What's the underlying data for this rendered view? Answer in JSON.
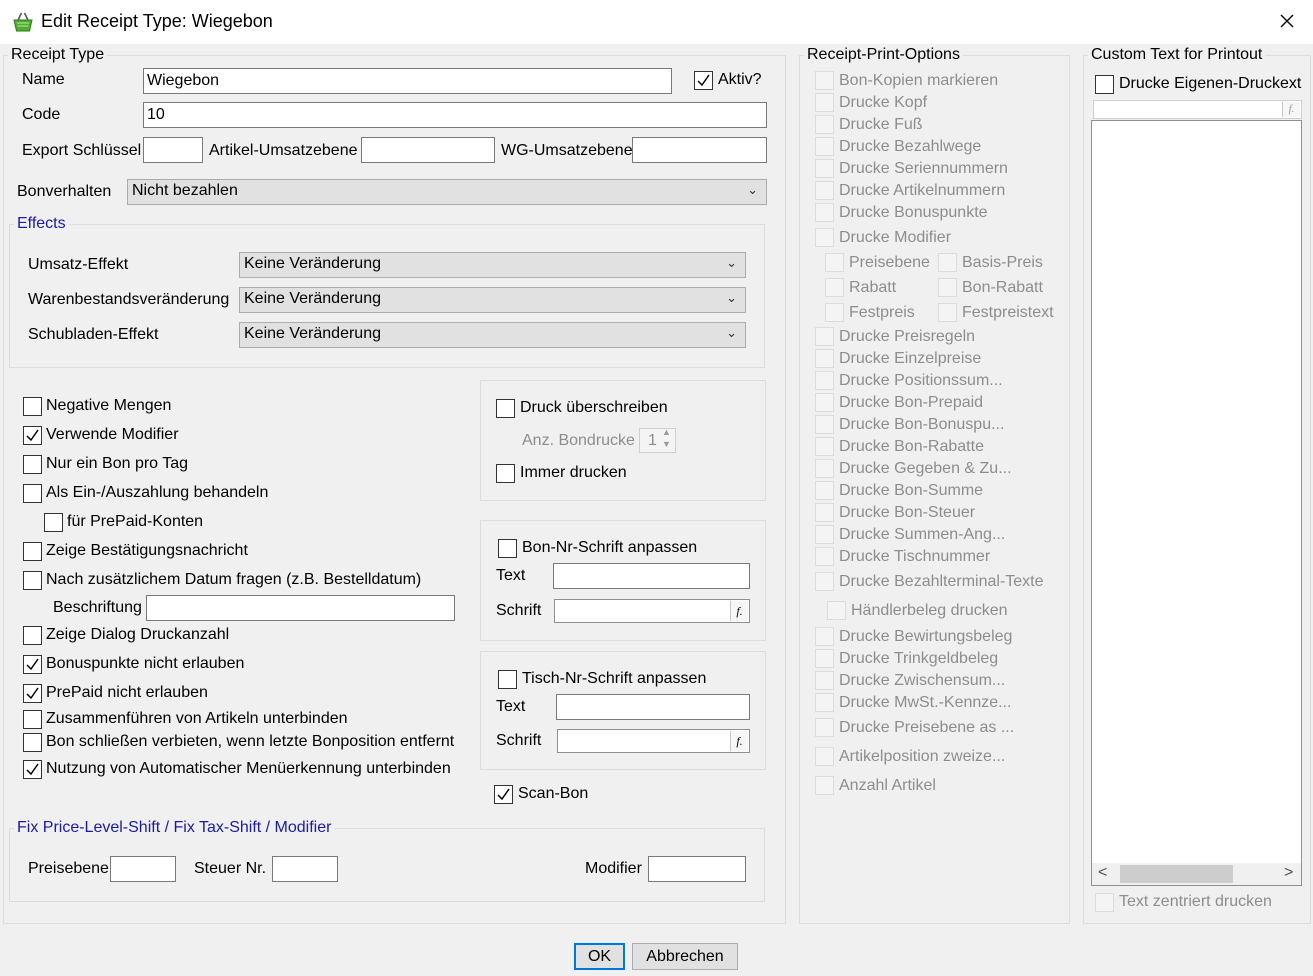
{
  "window": {
    "title": "Edit Receipt Type: Wiegebon",
    "icon": "shopping-basket-icon",
    "close_icon": "close-icon"
  },
  "receipt_type": {
    "legend": "Receipt Type",
    "name_label": "Name",
    "name_value": "Wiegebon",
    "aktiv_label": "Aktiv?",
    "code_label": "Code",
    "code_value": "10",
    "export_label": "Export Schlüssel",
    "export_value": "",
    "artikel_label": "Artikel-Umsatzebene",
    "artikel_value": "",
    "wg_label": "WG-Umsatzebene",
    "wg_value": "",
    "bonverhalten_label": "Bonverhalten",
    "bonverhalten_value": "Nicht bezahlen"
  },
  "effects": {
    "legend": "Effects",
    "umsatz_label": "Umsatz-Effekt",
    "umsatz_value": "Keine Veränderung",
    "waren_label": "Warenbestandsveränderung",
    "waren_value": "Keine Veränderung",
    "schub_label": "Schubladen-Effekt",
    "schub_value": "Keine Veränderung"
  },
  "options": {
    "negative": "Negative Mengen",
    "modifier": "Verwende Modifier",
    "ein_bon": "Nur ein Bon pro Tag",
    "einaus": "Als Ein-/Auszahlung behandeln",
    "prepaid_konten": "für PrePaid-Konten",
    "bestaetigung": "Zeige Bestätigungsnachricht",
    "datum": "Nach zusätzlichem Datum fragen (z.B. Bestelldatum)",
    "beschriftung_label": "Beschriftung",
    "beschriftung_value": "",
    "druckanzahl": "Zeige Dialog Druckanzahl",
    "bonuspunkte": "Bonuspunkte nicht erlauben",
    "prepaid": "PrePaid nicht erlauben",
    "zusammen": "Zusammenführen von Artikeln unterbinden",
    "schliessen": "Bon schließen verbieten, wenn letzte Bonposition entfernt",
    "automatik": "Nutzung von Automatischer Menüerkennung unterbinden"
  },
  "druck": {
    "ueberschreiben": "Druck überschreiben",
    "anz_label": "Anz. Bondrucke",
    "anz_value": "1",
    "immer": "Immer drucken"
  },
  "bonnr": {
    "check": "Bon-Nr-Schrift anpassen",
    "text_label": "Text",
    "text_value": "",
    "schrift_label": "Schrift",
    "font_btn": "f."
  },
  "tischnr": {
    "check": "Tisch-Nr-Schrift anpassen",
    "text_label": "Text",
    "text_value": "",
    "schrift_label": "Schrift",
    "font_btn": "f."
  },
  "scan_bon": "Scan-Bon",
  "fix": {
    "legend": "Fix Price-Level-Shift  / Fix Tax-Shift / Modifier",
    "preisebene_label": "Preisebene",
    "preisebene_value": "",
    "steuer_label": "Steuer Nr.",
    "steuer_value": "",
    "modifier_label": "Modifier",
    "modifier_value": ""
  },
  "print_options": {
    "legend": "Receipt-Print-Options",
    "items": [
      "Bon-Kopien markieren",
      "Drucke Kopf",
      "Drucke Fuß",
      "Drucke Bezahlwege",
      "Drucke Seriennummern",
      "Drucke Artikelnummern",
      "Drucke Bonuspunkte",
      "Drucke Modifier"
    ],
    "modifier_sub": [
      "Preisebene",
      "Basis-Preis",
      "Rabatt",
      "Bon-Rabatt",
      "Festpreis",
      "Festpreistext"
    ],
    "items2": [
      "Drucke Preisregeln",
      "Drucke Einzelpreise",
      "Drucke Positionssum...",
      "Drucke Bon-Prepaid",
      "Drucke Bon-Bonuspu...",
      "Drucke Bon-Rabatte",
      "Drucke Gegeben & Zu...",
      "Drucke Bon-Summe",
      "Drucke Bon-Steuer",
      "Drucke Summen-Ang...",
      "Drucke Tischnummer",
      "Drucke Bezahlterminal-Texte"
    ],
    "haendler": "Händlerbeleg drucken",
    "items3": [
      "Drucke Bewirtungsbeleg",
      "Drucke Trinkgeldbeleg",
      "Drucke Zwischensum...",
      "Drucke MwSt.-Kennze...",
      "Drucke Preisebene as ..."
    ],
    "artikelpos": "Artikelposition zweize...",
    "anzahl": "Anzahl Artikel"
  },
  "custom": {
    "legend": "Custom Text for Printout",
    "check": "Drucke Eigenen-Druckext",
    "font_btn": "f.",
    "scroll_left": "<",
    "scroll_right": ">",
    "zentriert": "Text zentriert drucken"
  },
  "buttons": {
    "ok": "OK",
    "cancel": "Abbrechen"
  }
}
